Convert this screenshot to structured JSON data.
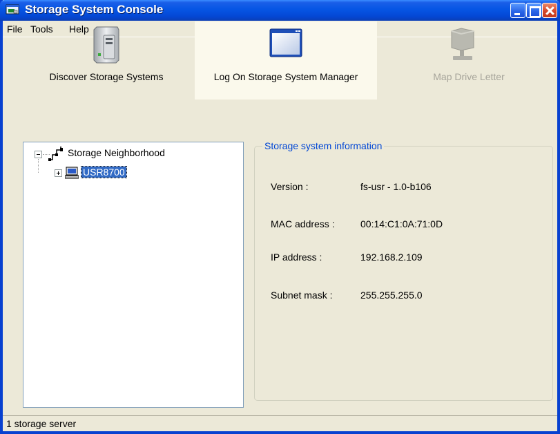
{
  "window": {
    "title": "Storage System Console"
  },
  "menu": [
    "File",
    "Tools",
    "Help"
  ],
  "toolbar": {
    "discover_label": "Discover Storage Systems",
    "logon_label": "Log On Storage System Manager",
    "map_label": "Map Drive Letter"
  },
  "tree": {
    "root_label": "Storage Neighborhood",
    "child_label": "USR8700"
  },
  "info": {
    "group_title": "Storage system information",
    "rows": [
      {
        "label": "Version :",
        "value": "fs-usr - 1.0-b106"
      },
      {
        "label": "MAC address :",
        "value": "00:14:C1:0A:71:0D"
      },
      {
        "label": "IP address :",
        "value": "192.168.2.109"
      },
      {
        "label": "Subnet mask :",
        "value": "255.255.255.0"
      }
    ]
  },
  "status": {
    "text": "1 storage server"
  },
  "colors": {
    "titlebar": "#0655E4",
    "window_bg": "#ECE9D8",
    "selection": "#316AC5",
    "group_title": "#0046D5"
  }
}
